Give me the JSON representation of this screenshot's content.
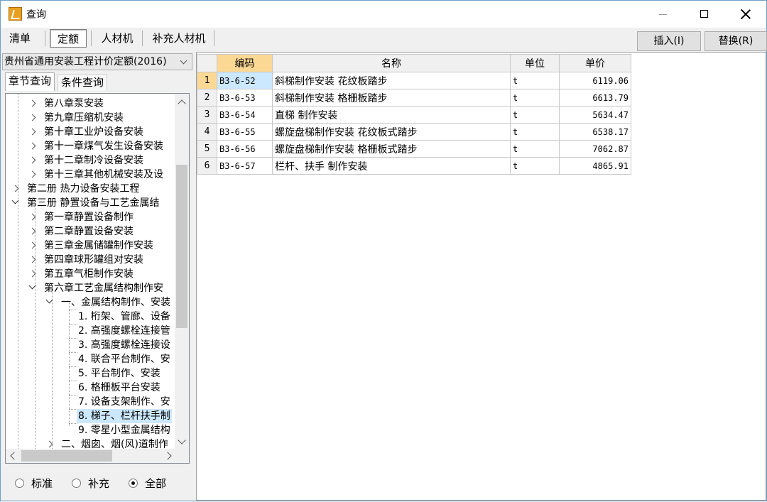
{
  "window": {
    "title": "查询"
  },
  "tabs": [
    {
      "label": "清单"
    },
    {
      "label": "定额"
    },
    {
      "label": "人材机"
    },
    {
      "label": "补充人材机"
    }
  ],
  "buttons": {
    "insert": "插入(I)",
    "replace": "替换(R)"
  },
  "quota_dropdown": {
    "selected": "贵州省通用安装工程计价定额(2016)"
  },
  "subtabs": [
    {
      "label": "章节查询"
    },
    {
      "label": "条件查询"
    }
  ],
  "tree": [
    {
      "label": "第八章泵安装",
      "icon": "chevron-right-icon"
    },
    {
      "label": "第九章压缩机安装",
      "icon": "chevron-right-icon"
    },
    {
      "label": "第十章工业炉设备安装",
      "icon": "chevron-right-icon"
    },
    {
      "label": "第十一章煤气发生设备安装",
      "icon": "chevron-right-icon"
    },
    {
      "label": "第十二章制冷设备安装",
      "icon": "chevron-right-icon"
    },
    {
      "label": "第十三章其他机械安装及设",
      "icon": "chevron-right-icon"
    },
    {
      "label": "第二册 热力设备安装工程",
      "icon": "chevron-right-icon"
    },
    {
      "label": "第三册 静置设备与工艺金属结",
      "icon": "chevron-down-icon"
    },
    {
      "label": "第一章静置设备制作",
      "icon": "chevron-right-icon"
    },
    {
      "label": "第二章静置设备安装",
      "icon": "chevron-right-icon"
    },
    {
      "label": "第三章金属储罐制作安装",
      "icon": "chevron-right-icon"
    },
    {
      "label": "第四章球形罐组对安装",
      "icon": "chevron-right-icon"
    },
    {
      "label": "第五章气柜制作安装",
      "icon": "chevron-right-icon"
    },
    {
      "label": "第六章工艺金属结构制作安",
      "icon": "chevron-down-icon"
    },
    {
      "label": "一、金属结构制作、安装",
      "icon": "chevron-down-icon"
    },
    {
      "label": "1. 桁架、管廊、设备",
      "icon": ""
    },
    {
      "label": "2. 高强度螺栓连接管",
      "icon": ""
    },
    {
      "label": "3. 高强度螺栓连接设",
      "icon": ""
    },
    {
      "label": "4. 联合平台制作、安",
      "icon": ""
    },
    {
      "label": "5. 平台制作、安装",
      "icon": ""
    },
    {
      "label": "6. 格栅板平台安装",
      "icon": ""
    },
    {
      "label": "7. 设备支架制作、安",
      "icon": ""
    },
    {
      "label": "8. 梯子、栏杆扶手制",
      "icon": ""
    },
    {
      "label": "9. 零星小型金属结构",
      "icon": ""
    },
    {
      "label": "二、烟囱、烟(风)道制作",
      "icon": "chevron-right-icon"
    }
  ],
  "radio_filter": {
    "options": [
      {
        "label": "标准"
      },
      {
        "label": "补充"
      },
      {
        "label": "全部"
      }
    ],
    "selected": "全部"
  },
  "table": {
    "columns": [
      "编码",
      "名称",
      "单位",
      "单价"
    ],
    "rows": [
      {
        "idx": "1",
        "code": "B3-6-52",
        "name": "斜梯制作安装 花纹板踏步",
        "unit": "t",
        "price": "6119.06"
      },
      {
        "idx": "2",
        "code": "B3-6-53",
        "name": "斜梯制作安装 格栅板踏步",
        "unit": "t",
        "price": "6613.79"
      },
      {
        "idx": "3",
        "code": "B3-6-54",
        "name": "直梯 制作安装",
        "unit": "t",
        "price": "5634.47"
      },
      {
        "idx": "4",
        "code": "B3-6-55",
        "name": "螺旋盘梯制作安装 花纹板式踏步",
        "unit": "t",
        "price": "6538.17"
      },
      {
        "idx": "5",
        "code": "B3-6-56",
        "name": "螺旋盘梯制作安装 格栅板式踏步",
        "unit": "t",
        "price": "7062.87"
      },
      {
        "idx": "6",
        "code": "B3-6-57",
        "name": "栏杆、扶手 制作安装",
        "unit": "t",
        "price": "4865.91"
      }
    ]
  },
  "colors": {
    "accent_header": "#fcd895",
    "selection": "#cce8ff",
    "border": "#6fa0c8"
  }
}
